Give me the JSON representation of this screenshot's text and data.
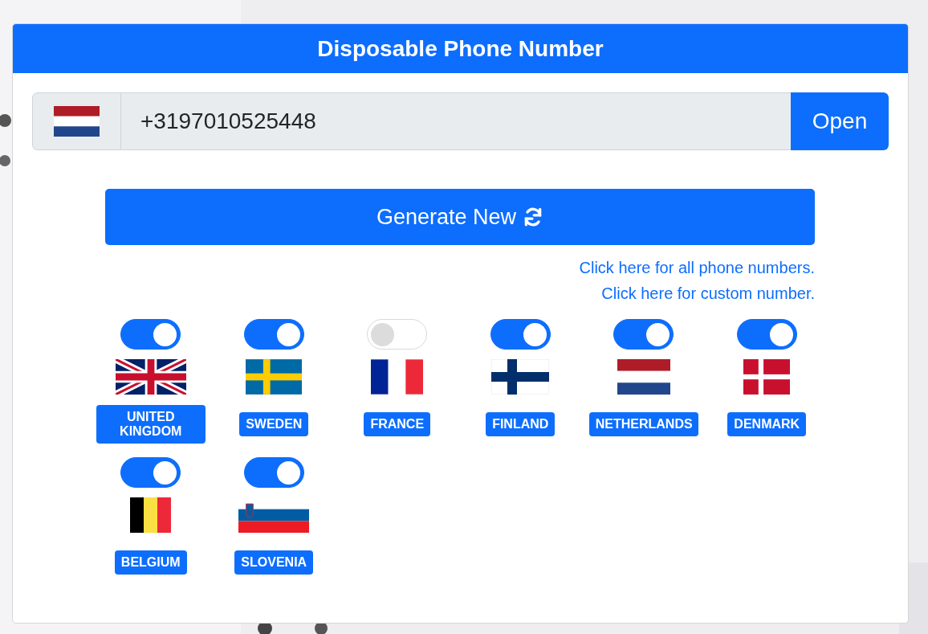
{
  "card": {
    "title": "Disposable Phone Number"
  },
  "number": {
    "kind": "nl",
    "value": "+3197010525448",
    "open_button": "Open"
  },
  "generate_button": "Generate New",
  "links": [
    "Click here for all phone numbers.",
    "Click here for custom number."
  ],
  "countries": [
    {
      "name": "UNITED KINGDOM",
      "kind": "gb",
      "on": true
    },
    {
      "name": "SWEDEN",
      "kind": "se",
      "on": true
    },
    {
      "name": "FRANCE",
      "kind": "fr",
      "on": false
    },
    {
      "name": "FINLAND",
      "kind": "fi",
      "on": true
    },
    {
      "name": "NETHERLANDS",
      "kind": "nl",
      "on": true
    },
    {
      "name": "DENMARK",
      "kind": "dk",
      "on": true
    },
    {
      "name": "BELGIUM",
      "kind": "be",
      "on": true
    },
    {
      "name": "SLOVENIA",
      "kind": "si",
      "on": true
    }
  ]
}
